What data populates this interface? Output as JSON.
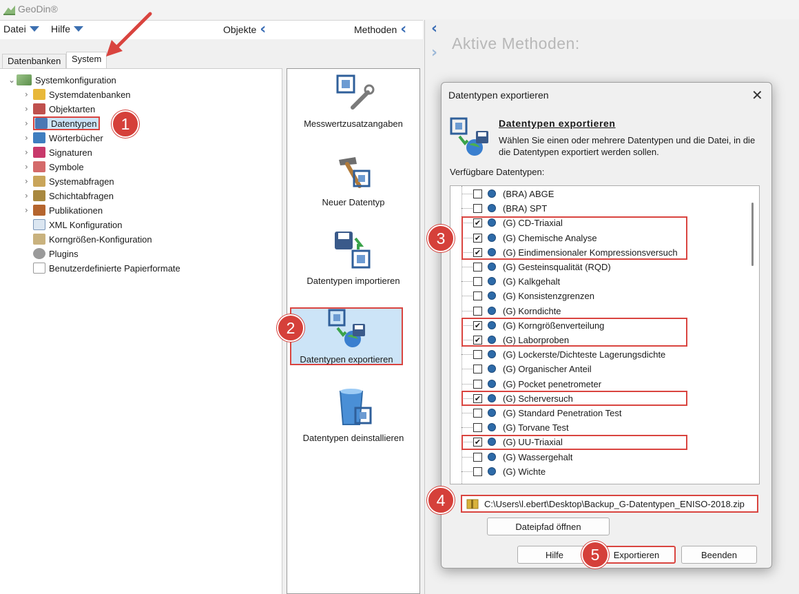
{
  "app": {
    "title": "GeoDin®"
  },
  "menu": {
    "datei": "Datei",
    "hilfe": "Hilfe",
    "objekte": "Objekte",
    "methoden": "Methoden"
  },
  "tabs": [
    "Datenbanken",
    "System"
  ],
  "tree": {
    "root": "Systemkonfiguration",
    "items": [
      "Systemdatenbanken",
      "Objektarten",
      "Datentypen",
      "Wörterbücher",
      "Signaturen",
      "Symbole",
      "Systemabfragen",
      "Schichtabfragen",
      "Publikationen",
      "XML Konfiguration",
      "Korngrößen-Konfiguration",
      "Plugins",
      "Benutzerdefinierte Papierformate"
    ]
  },
  "methods": [
    "Messwertzusatzangaben",
    "Neuer Datentyp",
    "Datentypen importieren",
    "Datentypen exportieren",
    "Datentypen deinstallieren"
  ],
  "right": {
    "title": "Aktive Methoden:"
  },
  "dialog": {
    "title": "Datentypen exportieren",
    "heading": "Datentypen exportieren",
    "description": "Wählen Sie einen oder mehrere Datentypen und die Datei, in die die Datentypen exportiert werden sollen.",
    "available_label": "Verfügbare Datentypen:",
    "datatypes": [
      {
        "label": "(BRA) ABGE",
        "checked": false
      },
      {
        "label": "(BRA) SPT",
        "checked": false
      },
      {
        "label": "(G) CD-Triaxial",
        "checked": true
      },
      {
        "label": "(G) Chemische Analyse",
        "checked": true
      },
      {
        "label": "(G) Eindimensionaler Kompressionsversuch",
        "checked": true
      },
      {
        "label": "(G) Gesteinsqualität (RQD)",
        "checked": false
      },
      {
        "label": "(G) Kalkgehalt",
        "checked": false
      },
      {
        "label": "(G) Konsistenzgrenzen",
        "checked": false
      },
      {
        "label": "(G) Korndichte",
        "checked": false
      },
      {
        "label": "(G) Korngrößenverteilung",
        "checked": true
      },
      {
        "label": "(G) Laborproben",
        "checked": true
      },
      {
        "label": "(G) Lockerste/Dichteste Lagerungsdichte",
        "checked": false
      },
      {
        "label": "(G) Organischer Anteil",
        "checked": false
      },
      {
        "label": "(G) Pocket penetrometer",
        "checked": false
      },
      {
        "label": "(G) Scherversuch",
        "checked": true
      },
      {
        "label": "(G) Standard Penetration Test",
        "checked": false
      },
      {
        "label": "(G) Torvane Test",
        "checked": false
      },
      {
        "label": "(G) UU-Triaxial",
        "checked": true
      },
      {
        "label": "(G) Wassergehalt",
        "checked": false
      },
      {
        "label": "(G) Wichte",
        "checked": false
      }
    ],
    "file_path": "C:\\Users\\l.ebert\\Desktop\\Backup_G-Datentypen_ENISO-2018.zip",
    "open_path_button": "Dateipfad öffnen",
    "help_button": "Hilfe",
    "export_button": "Exportieren",
    "close_button": "Beenden"
  },
  "badges": [
    "1",
    "2",
    "3",
    "4",
    "5"
  ],
  "colors": {
    "accent": "#3a6db5",
    "highlight": "#d9443f",
    "selection": "#cce4f7"
  }
}
